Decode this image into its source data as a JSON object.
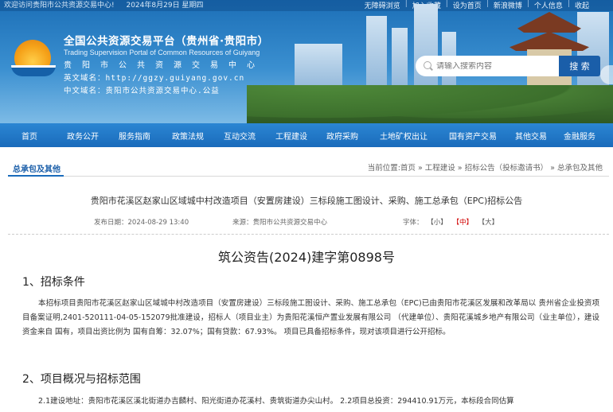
{
  "topbar": {
    "welcome": "欢迎访问贵阳市公共资源交易中心!",
    "date": "2024年8月29日 星期四",
    "links": [
      "无障碍浏览",
      "加入收藏",
      "设为首页",
      "新浪微博",
      "个人信息",
      "收起"
    ]
  },
  "header": {
    "title": "全国公共资源交易平台（贵州省·贵阳市）",
    "title_en": "Trading Supervision Portal of Common Resources of Guiyang",
    "subtitle": "贵阳市公共资源交易中心",
    "domain_en": "英文域名：http://ggzy.guiyang.gov.cn",
    "domain_cn": "中文域名：贵阳市公共资源交易中心.公益"
  },
  "search": {
    "placeholder": "请输入搜索内容",
    "button_label": "搜 索"
  },
  "nav": {
    "items": [
      "首页",
      "政务公开",
      "服务指南",
      "政策法规",
      "互动交流",
      "工程建设",
      "政府采购",
      "土地矿权出让",
      "国有资产交易",
      "其他交易",
      "金融服务"
    ]
  },
  "section": {
    "title": "总承包及其他"
  },
  "breadcrumb": {
    "text": "当前位置:首页 » 工程建设 » 招标公告（投标邀请书） » 总承包及其他"
  },
  "article": {
    "title": "贵阳市花溪区赵家山区域城中村改造项目（安置房建设）三标段施工图设计、采购、施工总承包（EPC)招标公告",
    "published": "发布日期：2024-08-29 13:40",
    "source": "来源：贵阳市公共资源交易中心",
    "font_label": "字体：",
    "font_small": "【小】",
    "font_medium": "【中】",
    "font_large": "【大】",
    "doc_number": "筑公资告(2024)建字第0898号",
    "section1_heading": "1、招标条件",
    "section1_body": "本招标项目贵阳市花溪区赵家山区域城中村改造项目（安置房建设）三标段施工图设计、采购、施工总承包（EPC)已由贵阳市花溪区发展和改革局以 贵州省企业投资项目备案证明,2401-520111-04-05-152079批准建设，招标人（项目业主）为贵阳花溪恒产置业发展有限公司 （代建单位）、贵阳花溪城乡地产有限公司（业主单位），建设资金来自 国有，项目出资比例为 国有自筹：32.07%；国有贷款：67.93%。 项目已具备招标条件，现对该项目进行公开招标。",
    "section2_heading": "2、项目概况与招标范围",
    "section2_body": "2.1建设地址：贵阳市花溪区溪北街道办吉麟村、阳光街道办花溪村、贵筑街道办尖山村。 2.2项目总投资：294410.91万元，本标段合同估算"
  },
  "colors": {
    "nav_bg": "#1a6bbb",
    "link_blue": "#1a5ea9",
    "active_red": "#d10000"
  }
}
